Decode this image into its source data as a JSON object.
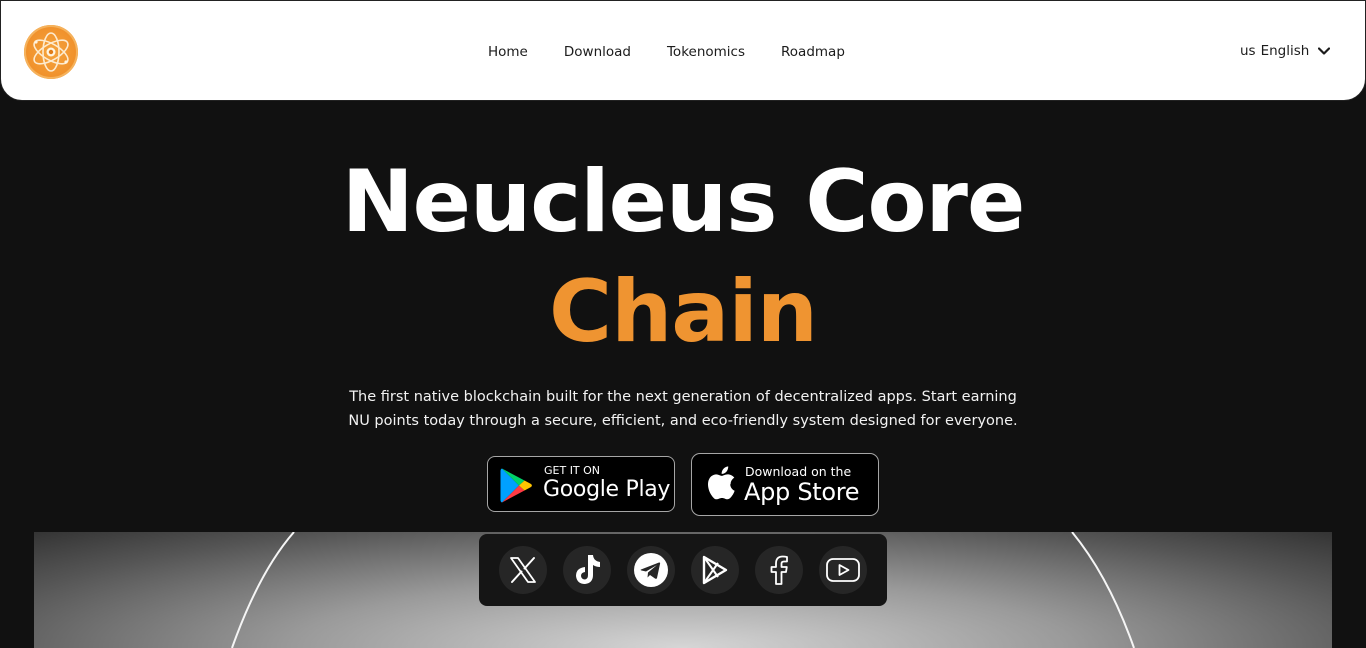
{
  "nav": {
    "logo_icon": "atom-logo-icon",
    "links": [
      "Home",
      "Download",
      "Tokenomics",
      "Roadmap"
    ],
    "language": {
      "code": "us",
      "label": "English",
      "icon": "chevron-down-icon"
    }
  },
  "hero": {
    "title_line1": "Neucleus Core",
    "title_line2": "Chain",
    "accent_color": "#ef9431",
    "subtitle": "The first native blockchain built for the next generation of decentralized apps. Start earning NU points today through a secure, efficient, and eco-friendly system designed for everyone."
  },
  "stores": {
    "google_play": {
      "small": "GET IT ON",
      "big": "Google Play",
      "icon": "google-play-icon"
    },
    "app_store": {
      "small": "Download on the",
      "big": "App Store",
      "icon": "apple-icon"
    }
  },
  "social": [
    "x-icon",
    "tiktok-icon",
    "telegram-icon",
    "play-store-icon",
    "facebook-icon",
    "youtube-icon"
  ]
}
